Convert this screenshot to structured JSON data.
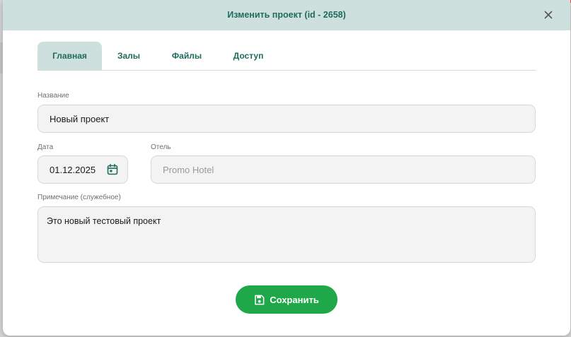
{
  "dialog": {
    "title": "Изменить проект (id - 2658)"
  },
  "tabs": [
    {
      "label": "Главная",
      "active": true
    },
    {
      "label": "Залы",
      "active": false
    },
    {
      "label": "Файлы",
      "active": false
    },
    {
      "label": "Доступ",
      "active": false
    }
  ],
  "form": {
    "name": {
      "label": "Название",
      "value": "Новый проект"
    },
    "date": {
      "label": "Дата",
      "value": "01.12.2025"
    },
    "hotel": {
      "label": "Отель",
      "placeholder": "Promo Hotel"
    },
    "note": {
      "label": "Примечание (служебное)",
      "value": "Это новый тестовый проект"
    }
  },
  "actions": {
    "save_label": "Сохранить"
  },
  "icons": {
    "close": "close-icon",
    "calendar": "calendar-icon",
    "save": "floppy-disk-icon"
  },
  "colors": {
    "header_bg": "#cde0de",
    "accent_text": "#1f6b5e",
    "save_button": "#1fa84a",
    "backdrop_pills": [
      "#2f7c6e",
      "#2f7c6e",
      "#8a8a8a",
      "#d45a5a"
    ]
  }
}
